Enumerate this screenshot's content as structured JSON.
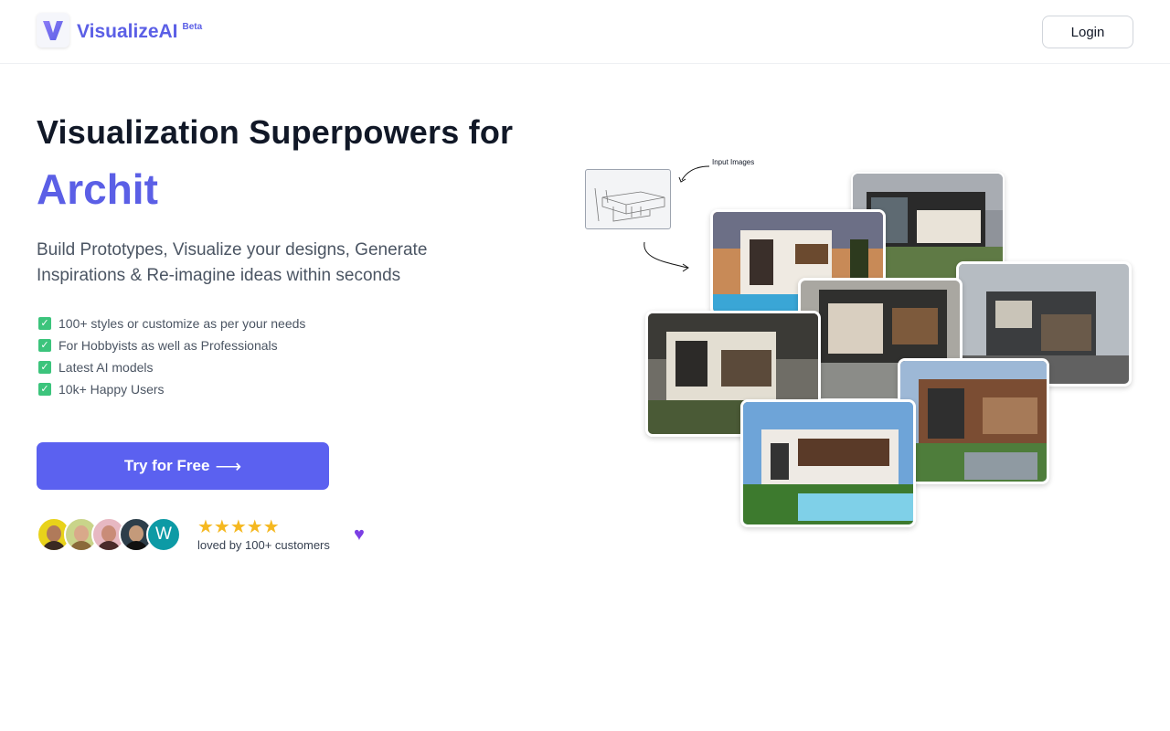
{
  "header": {
    "brand_name": "VisualizeAI",
    "brand_badge": "Beta",
    "login_label": "Login",
    "brand_color": "#5b5fe6"
  },
  "hero": {
    "title": "Visualization Superpowers for",
    "typed_word": "Archit",
    "subtitle": "Build Prototypes, Visualize your designs, Generate Inspirations & Re-imagine ideas within seconds",
    "features": [
      "100+ styles or customize as per your needs",
      "For Hobbyists as well as Professionals",
      "Latest AI models",
      "10k+ Happy Users"
    ],
    "cta_label": "Try for Free",
    "cta_icon": "arrow-right-icon",
    "cta_color": "#5b61f0"
  },
  "social_proof": {
    "avatar_letter": "W",
    "rating_stars": 5,
    "stars_text": "★★★★★",
    "loved_text": "loved by 100+ customers",
    "heart_icon": "purple-heart-icon"
  },
  "gallery": {
    "input_label": "Input Images",
    "image_icons": [
      "sketch-image",
      "house-render-1",
      "house-render-2",
      "house-render-3",
      "house-render-4",
      "house-render-5",
      "house-render-6",
      "house-render-7"
    ]
  }
}
